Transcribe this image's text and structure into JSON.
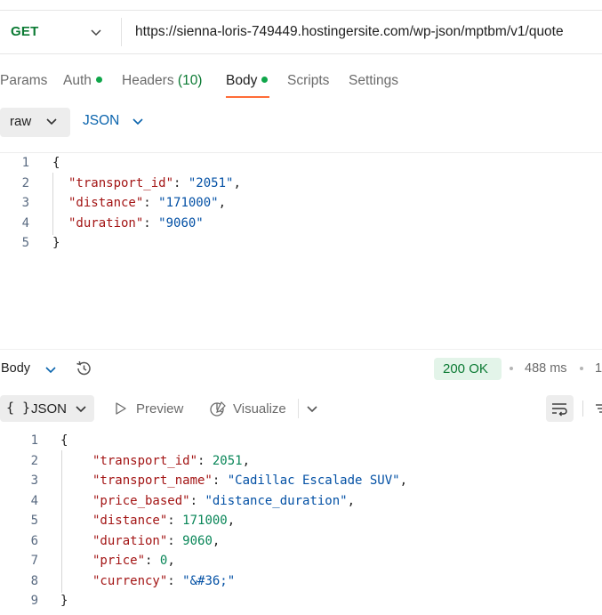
{
  "request": {
    "method": "GET",
    "url": "https://sienna-loris-749449.hostingersite.com/wp-json/mptbm/v1/quote"
  },
  "tabs": [
    {
      "label": "Params"
    },
    {
      "label": "Auth",
      "indicator": "green-dot"
    },
    {
      "label": "Headers",
      "count": "(10)"
    },
    {
      "label": "Body",
      "indicator": "green-dot",
      "active": true
    },
    {
      "label": "Scripts"
    },
    {
      "label": "Settings"
    }
  ],
  "body_options": {
    "mode": "raw",
    "language": "JSON"
  },
  "request_body": {
    "line_numbers": [
      "1",
      "2",
      "3",
      "4",
      "5"
    ],
    "open_brace": "{",
    "close_brace": "}",
    "lines": [
      {
        "key": "\"transport_id\"",
        "sep": ": ",
        "value": "\"2051\"",
        "trail": ","
      },
      {
        "key": "\"distance\"",
        "sep": ": ",
        "value": "\"171000\"",
        "trail": ","
      },
      {
        "key": "\"duration\"",
        "sep": ": ",
        "value": "\"9060\"",
        "trail": ""
      }
    ]
  },
  "response_header": {
    "label": "Body",
    "status": "200 OK",
    "time": "488 ms",
    "size_clipped": "1"
  },
  "response_toolbar": {
    "format_icon": "{ }",
    "format": "JSON",
    "preview": "Preview",
    "visualize": "Visualize"
  },
  "response_body": {
    "line_numbers": [
      "1",
      "2",
      "3",
      "4",
      "5",
      "6",
      "7",
      "8",
      "9"
    ],
    "open_brace": "{",
    "close_brace": "}",
    "lines": [
      {
        "key": "\"transport_id\"",
        "sep": ": ",
        "value": "2051",
        "type": "num",
        "trail": ","
      },
      {
        "key": "\"transport_name\"",
        "sep": ": ",
        "value": "\"Cadillac Escalade SUV\"",
        "type": "str",
        "trail": ","
      },
      {
        "key": "\"price_based\"",
        "sep": ": ",
        "value": "\"distance_duration\"",
        "type": "str",
        "trail": ","
      },
      {
        "key": "\"distance\"",
        "sep": ": ",
        "value": "171000",
        "type": "num",
        "trail": ","
      },
      {
        "key": "\"duration\"",
        "sep": ": ",
        "value": "9060",
        "type": "num",
        "trail": ","
      },
      {
        "key": "\"price\"",
        "sep": ": ",
        "value": "0",
        "type": "num",
        "trail": ","
      },
      {
        "key": "\"currency\"",
        "sep": ": ",
        "value": "\"&#36;\"",
        "type": "str",
        "trail": ""
      }
    ]
  },
  "colors": {
    "method": "#0b7a33",
    "active_tab_underline": "#ff6c37",
    "status_bg": "#e3f4e9",
    "json_key": "#a31515",
    "json_string": "#0451a5",
    "json_number": "#098658"
  },
  "icons": [
    "chevron-down-icon",
    "history-icon",
    "preview-play-icon",
    "visualize-icon",
    "wrap-lines-icon",
    "filter-icon"
  ]
}
